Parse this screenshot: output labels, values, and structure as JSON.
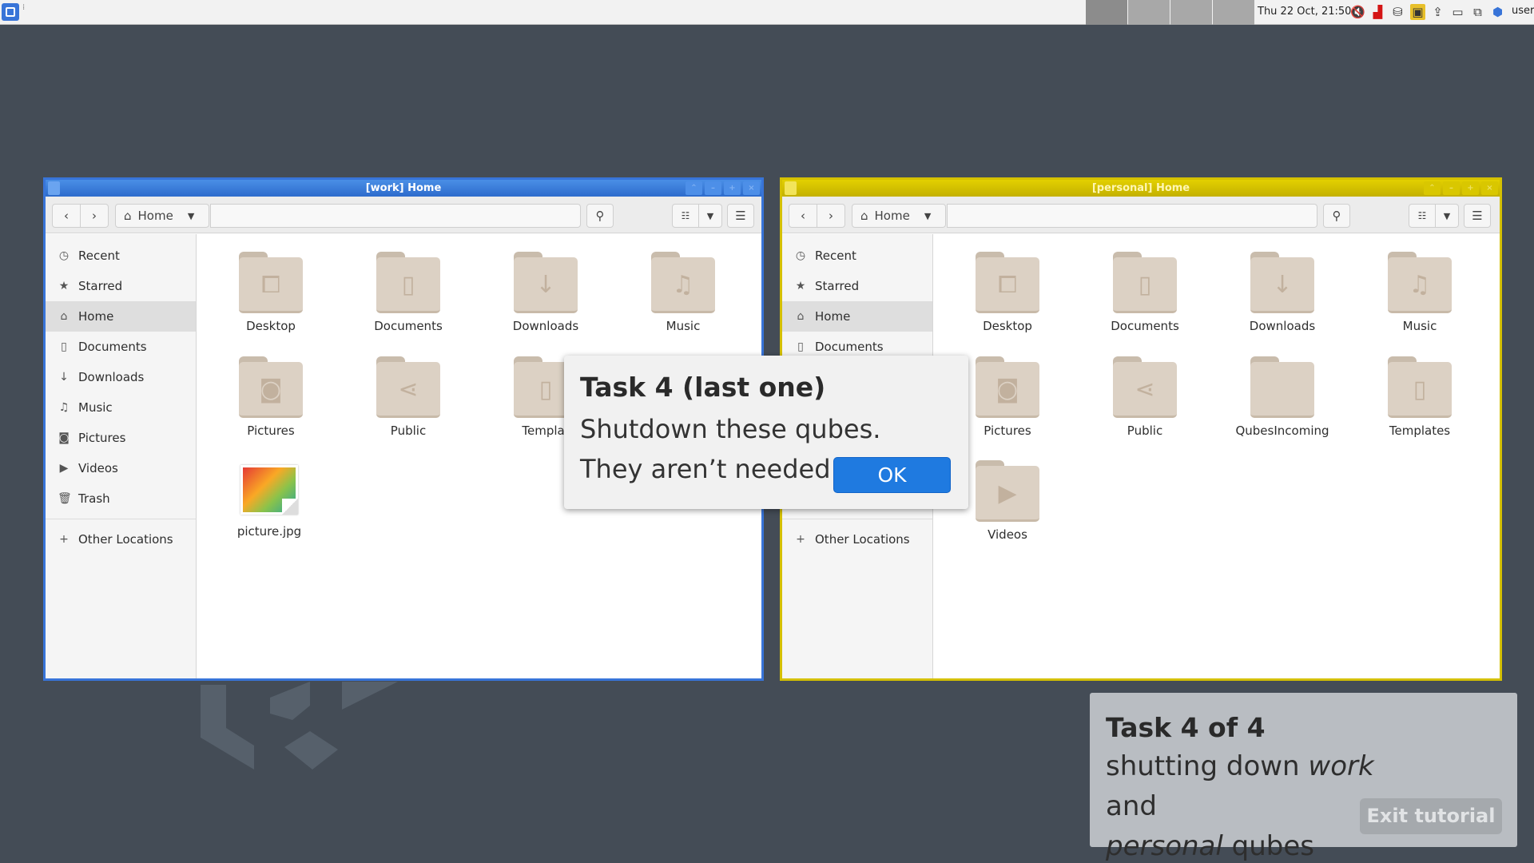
{
  "panel": {
    "clock": "Thu 22 Oct, 21:50",
    "user": "user",
    "tray_icons": [
      "volume-mute-icon",
      "network-icon",
      "qubes-domains-icon",
      "devices-icon",
      "updates-icon",
      "clipboard-icon",
      "screens-icon",
      "qube-manager-icon"
    ]
  },
  "work_window": {
    "title": "[work] Home",
    "color": "#3874d8",
    "location": "Home",
    "sidebar": [
      "Recent",
      "Starred",
      "Home",
      "Documents",
      "Downloads",
      "Music",
      "Pictures",
      "Videos",
      "Trash",
      "Other Locations"
    ],
    "files": [
      "Desktop",
      "Documents",
      "Downloads",
      "Music",
      "Pictures",
      "Public",
      "Templat",
      "picture.jpg"
    ]
  },
  "personal_window": {
    "title": "[personal] Home",
    "color": "#d4c000",
    "location": "Home",
    "sidebar": [
      "Recent",
      "Starred",
      "Home",
      "Documents",
      "Other Locations"
    ],
    "files": [
      "Desktop",
      "Documents",
      "Downloads",
      "Music",
      "Pictures",
      "Public",
      "QubesIncoming",
      "Templates",
      "Videos"
    ]
  },
  "task_popup": {
    "title": "Task 4 (last one)",
    "description": "Shutdown these qubes. They aren’t needed now",
    "ok_label": "OK"
  },
  "tutorial": {
    "title": "Task 4 of 4",
    "line1_pre": "shutting down ",
    "line1_em": "work",
    "line1_post": " and",
    "line2_em": "personal",
    "line2_post": " qubes",
    "exit_label": "Exit tutorial"
  }
}
